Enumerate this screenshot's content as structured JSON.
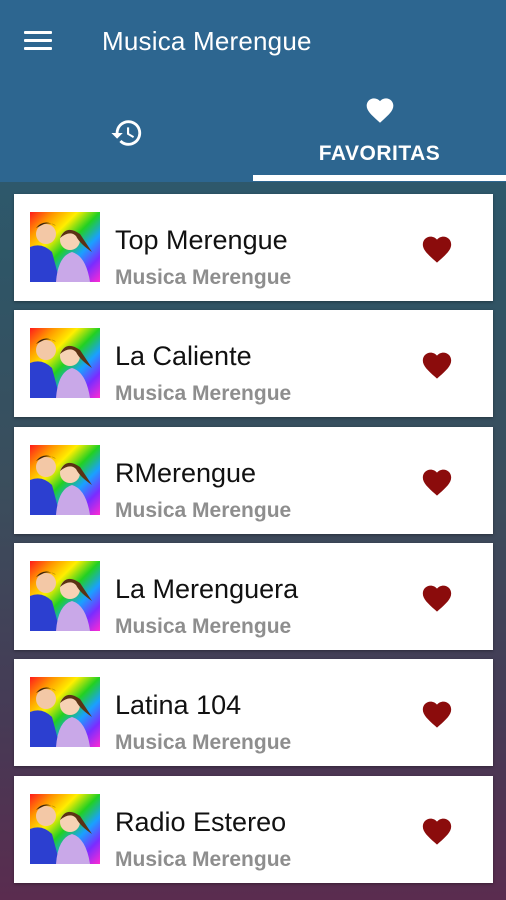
{
  "appbar": {
    "title": "Musica Merengue",
    "menu_icon": "hamburger-menu-icon"
  },
  "tabs": [
    {
      "id": "history",
      "icon": "history-icon",
      "label": "",
      "active": false
    },
    {
      "id": "favorites",
      "icon": "heart-icon",
      "label": "FAVORITAS",
      "active": true
    }
  ],
  "colors": {
    "appbar": "#2d6690",
    "heart": "#8b0c0c",
    "subtitle": "#8e8e8e"
  },
  "stations": [
    {
      "name": "Top Merengue",
      "genre": "Musica Merengue",
      "favorite": true
    },
    {
      "name": "La Caliente",
      "genre": "Musica Merengue",
      "favorite": true
    },
    {
      "name": "RMerengue",
      "genre": "Musica Merengue",
      "favorite": true
    },
    {
      "name": "La Merenguera",
      "genre": "Musica Merengue",
      "favorite": true
    },
    {
      "name": "Latina 104",
      "genre": "Musica Merengue",
      "favorite": true
    },
    {
      "name": "Radio Estereo",
      "genre": "Musica Merengue",
      "favorite": true
    }
  ]
}
